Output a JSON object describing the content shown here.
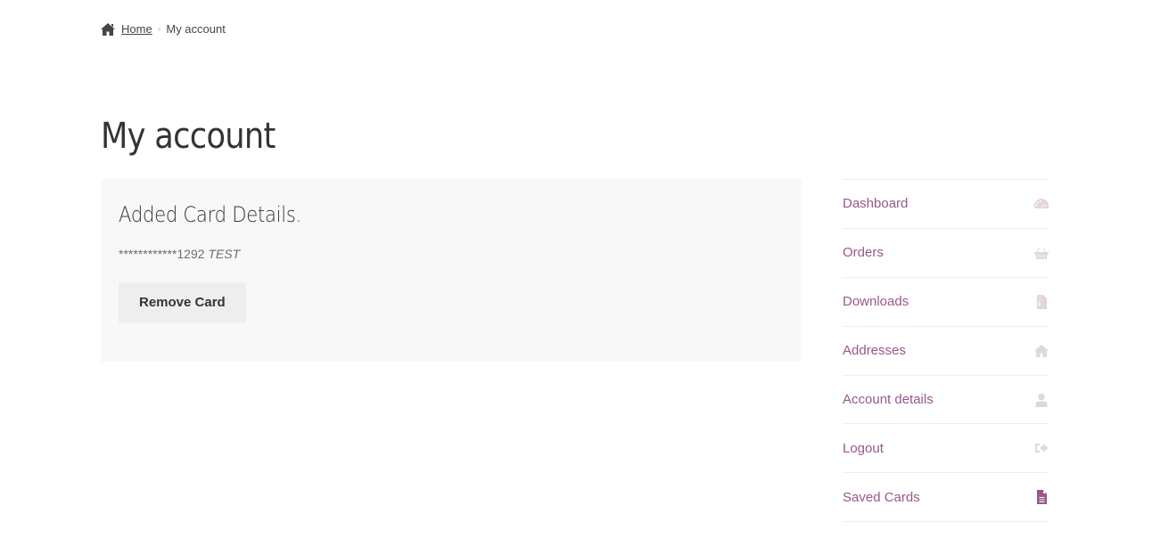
{
  "breadcrumb": {
    "home_label": "Home",
    "separator": "›",
    "current": "My account"
  },
  "page_title": "My account",
  "content": {
    "heading": "Added Card Details.",
    "card_masked_number": "************1292",
    "card_type": "TEST",
    "remove_button_label": "Remove Card"
  },
  "navigation": {
    "items": [
      {
        "label": "Dashboard",
        "icon": "dashboard-gauge-icon",
        "active": false
      },
      {
        "label": "Orders",
        "icon": "shopping-basket-icon",
        "active": false
      },
      {
        "label": "Downloads",
        "icon": "file-archive-icon",
        "active": false
      },
      {
        "label": "Addresses",
        "icon": "home-icon",
        "active": false
      },
      {
        "label": "Account details",
        "icon": "user-icon",
        "active": false
      },
      {
        "label": "Logout",
        "icon": "sign-out-icon",
        "active": false
      },
      {
        "label": "Saved Cards",
        "icon": "file-text-icon",
        "active": true
      }
    ]
  },
  "colors": {
    "accent": "#96588a",
    "icon_inactive": "#e3d5e0",
    "panel_bg": "#f8f8f8",
    "button_bg": "#eeeeee",
    "text": "#43454b"
  }
}
